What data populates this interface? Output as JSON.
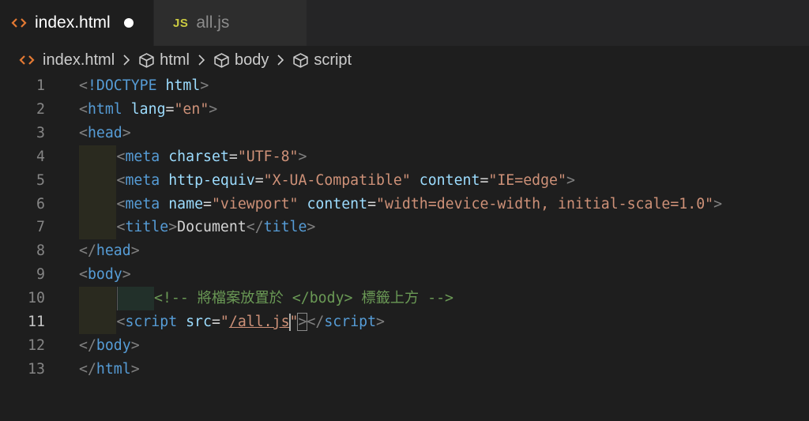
{
  "tabs": [
    {
      "label": "index.html",
      "icon": "html-file-icon",
      "dirty": true,
      "active": true
    },
    {
      "label": "all.js",
      "icon": "js-file-icon",
      "badge": "JS",
      "active": false
    }
  ],
  "breadcrumb": {
    "file": "index.html",
    "items": [
      "html",
      "body",
      "script"
    ]
  },
  "editor": {
    "current_line": 11,
    "lines": [
      {
        "n": "1",
        "tokens": [
          [
            "punc",
            "<"
          ],
          [
            "tag",
            "!DOCTYPE"
          ],
          [
            "txt",
            " "
          ],
          [
            "attr",
            "html"
          ],
          [
            "punc",
            ">"
          ]
        ]
      },
      {
        "n": "2",
        "tokens": [
          [
            "punc",
            "<"
          ],
          [
            "tag",
            "html"
          ],
          [
            "txt",
            " "
          ],
          [
            "attr",
            "lang"
          ],
          [
            "txt",
            "="
          ],
          [
            "str",
            "\"en\""
          ],
          [
            "punc",
            ">"
          ]
        ]
      },
      {
        "n": "3",
        "tokens": [
          [
            "punc",
            "<"
          ],
          [
            "tag",
            "head"
          ],
          [
            "punc",
            ">"
          ]
        ]
      },
      {
        "n": "4",
        "tokens": [
          [
            "punc",
            "<"
          ],
          [
            "tag",
            "meta"
          ],
          [
            "txt",
            " "
          ],
          [
            "attr",
            "charset"
          ],
          [
            "txt",
            "="
          ],
          [
            "str",
            "\"UTF-8\""
          ],
          [
            "punc",
            ">"
          ]
        ]
      },
      {
        "n": "5",
        "tokens": [
          [
            "punc",
            "<"
          ],
          [
            "tag",
            "meta"
          ],
          [
            "txt",
            " "
          ],
          [
            "attr",
            "http-equiv"
          ],
          [
            "txt",
            "="
          ],
          [
            "str",
            "\"X-UA-Compatible\""
          ],
          [
            "txt",
            " "
          ],
          [
            "attr",
            "content"
          ],
          [
            "txt",
            "="
          ],
          [
            "str",
            "\"IE=edge\""
          ],
          [
            "punc",
            ">"
          ]
        ]
      },
      {
        "n": "6",
        "tokens": [
          [
            "punc",
            "<"
          ],
          [
            "tag",
            "meta"
          ],
          [
            "txt",
            " "
          ],
          [
            "attr",
            "name"
          ],
          [
            "txt",
            "="
          ],
          [
            "str",
            "\"viewport\""
          ],
          [
            "txt",
            " "
          ],
          [
            "attr",
            "content"
          ],
          [
            "txt",
            "="
          ],
          [
            "str",
            "\"width=device-width, initial-scale=1.0\""
          ],
          [
            "punc",
            ">"
          ]
        ]
      },
      {
        "n": "7",
        "tokens": [
          [
            "punc",
            "<"
          ],
          [
            "tag",
            "title"
          ],
          [
            "punc",
            ">"
          ],
          [
            "txt",
            "Document"
          ],
          [
            "punc",
            "</"
          ],
          [
            "tag",
            "title"
          ],
          [
            "punc",
            ">"
          ]
        ]
      },
      {
        "n": "8",
        "tokens": [
          [
            "punc",
            "</"
          ],
          [
            "tag",
            "head"
          ],
          [
            "punc",
            ">"
          ]
        ]
      },
      {
        "n": "9",
        "tokens": [
          [
            "punc",
            "<"
          ],
          [
            "tag",
            "body"
          ],
          [
            "punc",
            ">"
          ]
        ]
      },
      {
        "n": "10",
        "tokens": [
          [
            "cmt",
            "<!-- 將檔案放置於 </body> 標籤上方 -->"
          ]
        ]
      },
      {
        "n": "11",
        "tokens": [
          [
            "punc",
            "<"
          ],
          [
            "tag",
            "script"
          ],
          [
            "txt",
            " "
          ],
          [
            "attr",
            "src"
          ],
          [
            "txt",
            "="
          ],
          [
            "str",
            "\""
          ],
          [
            "str-u",
            "/all.js"
          ],
          [
            "cursor",
            ""
          ],
          [
            "str",
            "\""
          ],
          [
            "punc-hl",
            ">"
          ],
          [
            "punc",
            "</"
          ],
          [
            "tag",
            "script"
          ],
          [
            "punc",
            ">"
          ]
        ]
      },
      {
        "n": "12",
        "tokens": [
          [
            "punc",
            "</"
          ],
          [
            "tag",
            "body"
          ],
          [
            "punc",
            ">"
          ]
        ]
      },
      {
        "n": "13",
        "tokens": [
          [
            "punc",
            "</"
          ],
          [
            "tag",
            "html"
          ],
          [
            "punc",
            ">"
          ]
        ]
      }
    ]
  }
}
